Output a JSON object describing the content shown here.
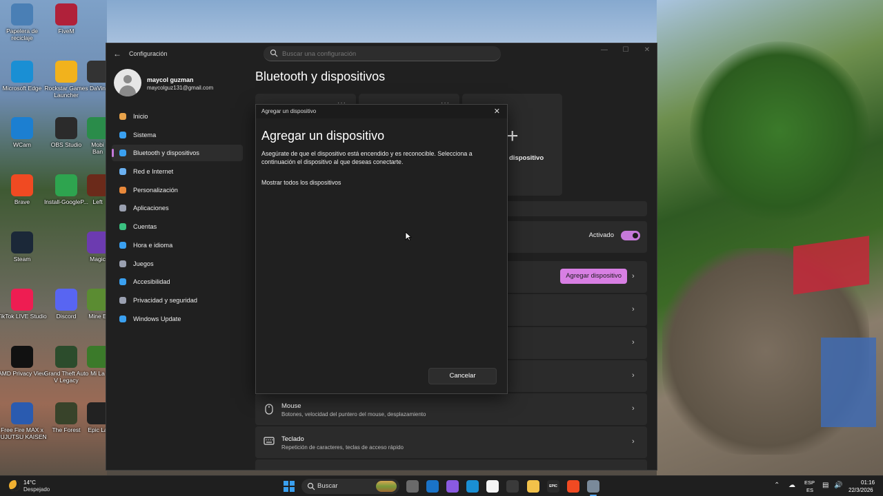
{
  "desktop": {
    "icons": [
      {
        "label": "Papelera de reciclaje",
        "icon": "recycle-bin-icon",
        "color": "#4a7fb5"
      },
      {
        "label": "FiveM",
        "icon": "fivem-icon",
        "color": "#b0213a"
      },
      {
        "label": "Microsoft Edge",
        "icon": "edge-icon",
        "color": "#1a8fd4"
      },
      {
        "label": "Rockstar Games Launcher",
        "icon": "rockstar-icon",
        "color": "#f2b21c"
      },
      {
        "label": "DaVin",
        "icon": "davinci-icon",
        "color": "#333333"
      },
      {
        "label": "WCam",
        "icon": "webcam-icon",
        "color": "#1c7fd1"
      },
      {
        "label": "OBS Studio",
        "icon": "obs-icon",
        "color": "#2b2b2b"
      },
      {
        "label": "Mobi Ban",
        "icon": "mobile-banking-icon",
        "color": "#2a8c4a"
      },
      {
        "label": "Brave",
        "icon": "brave-icon",
        "color": "#f04a22"
      },
      {
        "label": "Install-GoogleP...",
        "icon": "google-play-games-icon",
        "color": "#2ea44f"
      },
      {
        "label": "Left",
        "icon": "left4dead-icon",
        "color": "#6b2a1a"
      },
      {
        "label": "Steam",
        "icon": "steam-icon",
        "color": "#1b2838"
      },
      {
        "label": "Magic",
        "icon": "magic-icon",
        "color": "#6c3bb0"
      },
      {
        "label": "TikTok LIVE Studio",
        "icon": "tiktok-icon",
        "color": "#ee1d52"
      },
      {
        "label": "Discord",
        "icon": "discord-icon",
        "color": "#5865f2"
      },
      {
        "label": "Mine E",
        "icon": "minecraft-icon",
        "color": "#5b8c32"
      },
      {
        "label": "AMD Privacy View",
        "icon": "amd-privacy-icon",
        "color": "#111111"
      },
      {
        "label": "Grand Theft Auto V Legacy",
        "icon": "gta-icon",
        "color": "#2c4c2c"
      },
      {
        "label": "Mi La",
        "icon": "minecraft-launcher-icon",
        "color": "#3b7a2a"
      },
      {
        "label": "Free Fire MAX x JUJUTSU KAISEN",
        "icon": "free-fire-icon",
        "color": "#2a5bb0"
      },
      {
        "label": "The Forest",
        "icon": "the-forest-icon",
        "color": "#38432a"
      },
      {
        "label": "Epic La",
        "icon": "epic-games-icon",
        "color": "#222222"
      }
    ]
  },
  "window": {
    "app_title": "Configuración",
    "search_placeholder": "Buscar una configuración",
    "user": {
      "name": "maycol guzman",
      "email": "maycolguz131@gmail.com"
    },
    "nav": [
      {
        "label": "Inicio",
        "icon": "home-icon",
        "color": "#e8a24a"
      },
      {
        "label": "Sistema",
        "icon": "system-icon",
        "color": "#3aa0f0"
      },
      {
        "label": "Bluetooth y dispositivos",
        "icon": "bluetooth-icon",
        "color": "#3aa0f0",
        "active": true
      },
      {
        "label": "Red e Internet",
        "icon": "network-icon",
        "color": "#6ab0f0"
      },
      {
        "label": "Personalización",
        "icon": "brush-icon",
        "color": "#e8883a"
      },
      {
        "label": "Aplicaciones",
        "icon": "apps-icon",
        "color": "#9aa0b0"
      },
      {
        "label": "Cuentas",
        "icon": "accounts-icon",
        "color": "#3ac080"
      },
      {
        "label": "Hora e idioma",
        "icon": "time-language-icon",
        "color": "#3aa0f0"
      },
      {
        "label": "Juegos",
        "icon": "games-icon",
        "color": "#9aa0b0"
      },
      {
        "label": "Accesibilidad",
        "icon": "accessibility-icon",
        "color": "#3aa0f0"
      },
      {
        "label": "Privacidad y seguridad",
        "icon": "shield-icon",
        "color": "#9aa0b0"
      },
      {
        "label": "Windows Update",
        "icon": "windows-update-icon",
        "color": "#3aa0f0"
      }
    ],
    "page_title": "Bluetooth y dispositivos",
    "card_dots": "···",
    "add_card_label": "dispositivo",
    "bluetooth_state": "Activado",
    "add_device_button": "Agregar dispositivo",
    "rows": [
      {
        "title": "Mouse",
        "subtitle": "Botones, velocidad del puntero del mouse, desplazamiento",
        "icon": "mouse-icon"
      },
      {
        "title": "Teclado",
        "subtitle": "Repetición de caracteres, teclas de acceso rápido",
        "icon": "keyboard-icon"
      }
    ],
    "controls": {
      "minimize": "—",
      "maximize": "☐",
      "close": "✕"
    }
  },
  "dialog": {
    "bar_title": "Agregar un dispositivo",
    "heading": "Agregar un dispositivo",
    "description": "Asegúrate de que el dispositivo está encendido y es reconocible. Selecciona a continuación el dispositivo al que deseas conectarte.",
    "show_all": "Mostrar todos los dispositivos",
    "cancel": "Cancelar"
  },
  "taskbar": {
    "weather_temp": "14°C",
    "weather_desc": "Despejado",
    "search_label": "Buscar",
    "apps": [
      {
        "name": "task-view-icon",
        "color": "#6a6a6a",
        "glyph": ""
      },
      {
        "name": "outlook-icon",
        "color": "#1a73c8",
        "glyph": ""
      },
      {
        "name": "copilot-icon",
        "color": "#8a5ae0",
        "glyph": ""
      },
      {
        "name": "edge-taskbar-icon",
        "color": "#1a8fd4",
        "glyph": ""
      },
      {
        "name": "store-icon",
        "color": "#f4f4f4",
        "glyph": ""
      },
      {
        "name": "obs-taskbar-icon",
        "color": "#3a3a3a",
        "glyph": ""
      },
      {
        "name": "file-explorer-icon",
        "color": "#f2c14a",
        "glyph": ""
      },
      {
        "name": "epic-taskbar-icon",
        "color": "#2a2a2a",
        "glyph": "EPIC"
      },
      {
        "name": "brave-taskbar-icon",
        "color": "#f04a22",
        "glyph": ""
      },
      {
        "name": "settings-taskbar-icon",
        "color": "#7a8a9a",
        "glyph": "",
        "active": true
      }
    ],
    "lang_line1": "ESP",
    "lang_line2": "ES",
    "time": "01:16",
    "date": "22/3/2026"
  }
}
